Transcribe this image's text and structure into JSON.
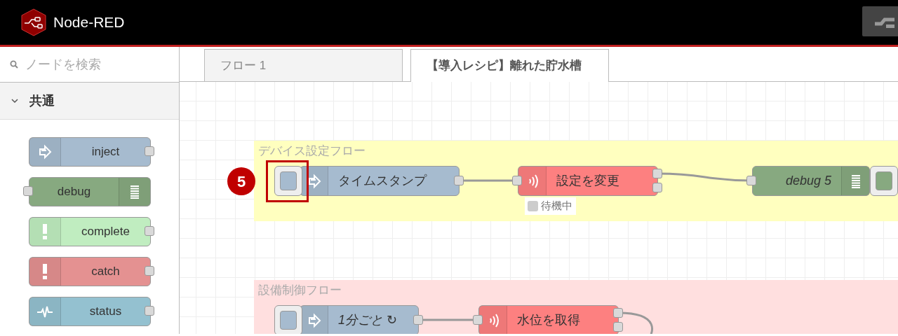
{
  "header": {
    "title": "Node-RED"
  },
  "palette": {
    "search": {
      "placeholder": "ノードを検索"
    },
    "category": {
      "label": "共通",
      "expanded": true
    },
    "nodes": [
      {
        "kind": "inject",
        "label": "inject",
        "color": "#a6bbcf"
      },
      {
        "kind": "debug",
        "label": "debug",
        "color": "#87a980"
      },
      {
        "kind": "complete",
        "label": "complete",
        "color": "#c0edc0"
      },
      {
        "kind": "catch",
        "label": "catch",
        "color": "#e49191"
      },
      {
        "kind": "status",
        "label": "status",
        "color": "#94c1d0"
      }
    ]
  },
  "tabs": [
    {
      "label": "フロー 1",
      "selected": false
    },
    {
      "label": "【導入レシピ】離れた貯水槽",
      "selected": true
    }
  ],
  "canvas": {
    "groups": [
      {
        "label": "デバイス設定フロー",
        "color": "#ffffbf",
        "nodes": [
          {
            "kind": "inject",
            "label": "タイムスタンプ",
            "italic": false,
            "color": "#a6bbcf",
            "marker": "5"
          },
          {
            "kind": "device",
            "label": "設定を変更",
            "italic": false,
            "color": "#fd8080",
            "status": {
              "text": "待機中",
              "color": "#cccccc"
            }
          },
          {
            "kind": "debug",
            "label": "debug 5",
            "italic": true,
            "color": "#87a980"
          }
        ]
      },
      {
        "label": "設備制御フロー",
        "color": "#ffdfdf",
        "nodes": [
          {
            "kind": "inject",
            "label": "1分ごと ↻",
            "italic": true,
            "color": "#a6bbcf"
          },
          {
            "kind": "device",
            "label": "水位を取得",
            "italic": false,
            "color": "#fd8080"
          }
        ]
      }
    ]
  }
}
